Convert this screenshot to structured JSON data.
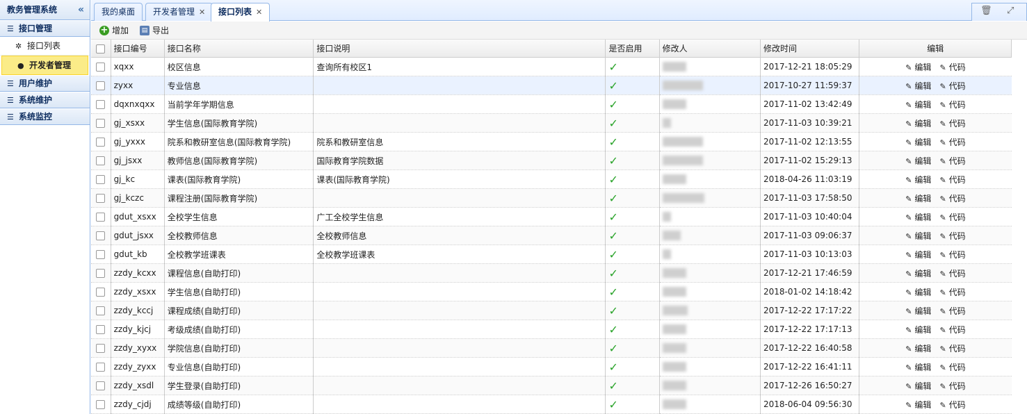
{
  "sidebar": {
    "title": "教务管理系统",
    "collapse_icon": "double-chevron-left-icon",
    "groups": [
      {
        "label": "接口管理"
      },
      {
        "label": "用户维护"
      },
      {
        "label": "系统维护"
      },
      {
        "label": "系统监控"
      }
    ],
    "items": [
      {
        "label": "接口列表",
        "icon": "gear-icon"
      },
      {
        "label": "开发者管理",
        "icon": "user-icon"
      }
    ]
  },
  "tabs": [
    {
      "label": "我的桌面"
    },
    {
      "label": "开发者管理"
    },
    {
      "label": "接口列表"
    }
  ],
  "toolbar": {
    "add_label": "增加",
    "export_label": "导出"
  },
  "table": {
    "headers": [
      "接口编号",
      "接口名称",
      "接口说明",
      "是否启用",
      "修改人",
      "修改时间",
      "编辑"
    ],
    "edit_label": "编辑",
    "code_label": "代码",
    "rows": [
      {
        "code": "xqxx",
        "name": "校区信息",
        "desc": "查询所有校区1",
        "time": "2017-12-21 18:05:29"
      },
      {
        "code": "zyxx",
        "name": "专业信息",
        "desc": "",
        "time": "2017-10-27 11:59:37"
      },
      {
        "code": "dqxnxqxx",
        "name": "当前学年学期信息",
        "desc": "",
        "time": "2017-11-02 13:42:49"
      },
      {
        "code": "gj_xsxx",
        "name": "学生信息(国际教育学院)",
        "desc": "",
        "time": "2017-11-03 10:39:21"
      },
      {
        "code": "gj_yxxx",
        "name": "院系和教研室信息(国际教育学院)",
        "desc": "院系和教研室信息",
        "time": "2017-11-02 12:13:55"
      },
      {
        "code": "gj_jsxx",
        "name": "教师信息(国际教育学院)",
        "desc": "国际教育学院数据",
        "time": "2017-11-02 15:29:13"
      },
      {
        "code": "gj_kc",
        "name": "课表(国际教育学院)",
        "desc": "课表(国际教育学院)",
        "time": "2018-04-26 11:03:19"
      },
      {
        "code": "gj_kczc",
        "name": "课程注册(国际教育学院)",
        "desc": "",
        "time": "2017-11-03 17:58:50"
      },
      {
        "code": "gdut_xsxx",
        "name": "全校学生信息",
        "desc": "广工全校学生信息",
        "time": "2017-11-03 10:40:04"
      },
      {
        "code": "gdut_jsxx",
        "name": "全校教师信息",
        "desc": "全校教师信息",
        "time": "2017-11-03 09:06:37"
      },
      {
        "code": "gdut_kb",
        "name": "全校教学班课表",
        "desc": "全校教学班课表",
        "time": "2017-11-03 10:13:03"
      },
      {
        "code": "zzdy_kcxx",
        "name": "课程信息(自助打印)",
        "desc": "",
        "time": "2017-12-21 17:46:59"
      },
      {
        "code": "zzdy_xsxx",
        "name": "学生信息(自助打印)",
        "desc": "",
        "time": "2018-01-02 14:18:42"
      },
      {
        "code": "zzdy_kccj",
        "name": "课程成绩(自助打印)",
        "desc": "",
        "time": "2017-12-22 17:17:22"
      },
      {
        "code": "zzdy_kjcj",
        "name": "考级成绩(自助打印)",
        "desc": "",
        "time": "2017-12-22 17:17:13"
      },
      {
        "code": "zzdy_xyxx",
        "name": "学院信息(自助打印)",
        "desc": "",
        "time": "2017-12-22 16:40:58"
      },
      {
        "code": "zzdy_zyxx",
        "name": "专业信息(自助打印)",
        "desc": "",
        "time": "2017-12-22 16:41:11"
      },
      {
        "code": "zzdy_xsdl",
        "name": "学生登录(自助打印)",
        "desc": "",
        "time": "2017-12-26 16:50:27"
      },
      {
        "code": "zzdy_cjdj",
        "name": "成绩等级(自助打印)",
        "desc": "",
        "time": "2018-06-04 09:56:30"
      }
    ]
  }
}
